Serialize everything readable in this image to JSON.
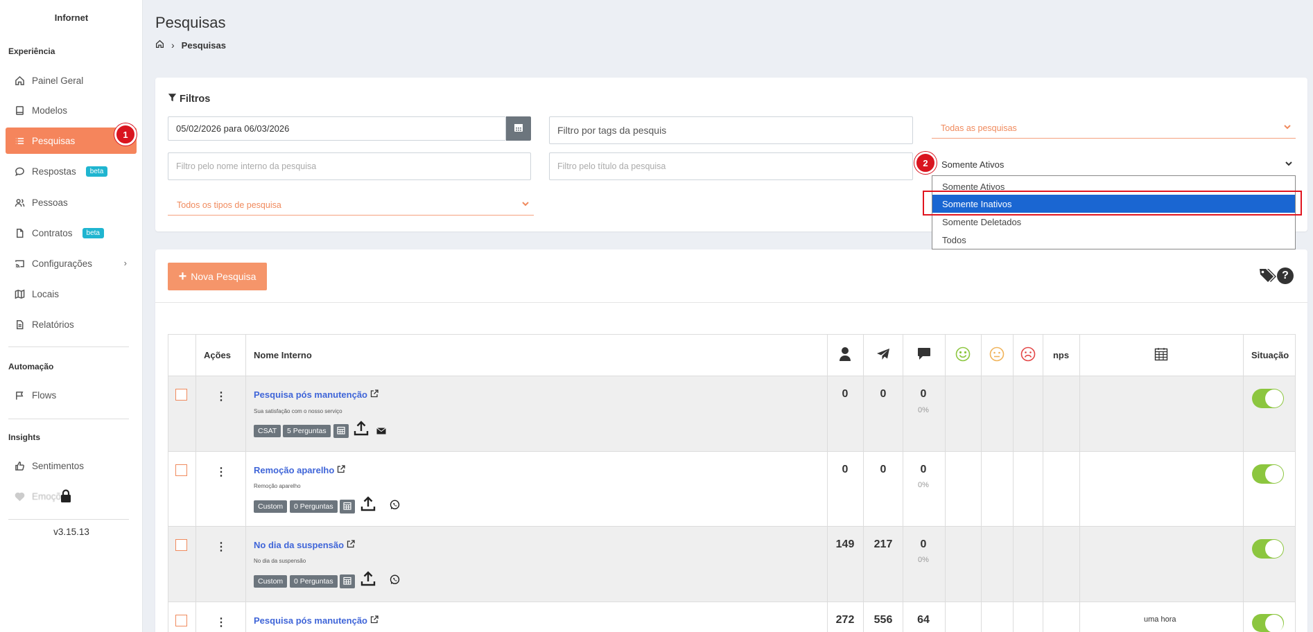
{
  "sidebar": {
    "brand": "Infornet",
    "sections": {
      "experiencia": "Experiência",
      "automacao": "Automação",
      "insights": "Insights"
    },
    "items": {
      "painel": "Painel Geral",
      "modelos": "Modelos",
      "pesquisas": "Pesquisas",
      "respostas": "Respostas",
      "pessoas": "Pessoas",
      "contratos": "Contratos",
      "configuracoes": "Configurações",
      "locais": "Locais",
      "relatorios": "Relatórios",
      "flows": "Flows",
      "sentimentos": "Sentimentos",
      "emocoes": "Emoções"
    },
    "beta_label": "beta",
    "version": "v3.15.13"
  },
  "annotations": {
    "badge1": "1",
    "badge2": "2"
  },
  "header": {
    "title": "Pesquisas",
    "breadcrumb_current": "Pesquisas"
  },
  "filters": {
    "title": "Filtros",
    "date_range": "05/02/2026 para 06/03/2026",
    "tags_placeholder": "Filtro por tags da pesquis",
    "internal_name_placeholder": "Filtro pelo nome interno da pesquisa",
    "title_placeholder": "Filtro pelo título da pesquisa",
    "all_surveys": "Todas as pesquisas",
    "all_types": "Todos os tipos de pesquisa",
    "status_selected": "Somente Ativos",
    "status_options": [
      "Somente Ativos",
      "Somente Inativos",
      "Somente Deletados",
      "Todos"
    ]
  },
  "toolbar": {
    "new_button": "Nova Pesquisa"
  },
  "table": {
    "headers": {
      "acoes": "Ações",
      "nome": "Nome Interno",
      "nps": "nps",
      "situacao": "Situação"
    },
    "rows": [
      {
        "title": "Pesquisa pós manutenção",
        "subtitle": "Sua satisfação com o nosso serviço",
        "type": "CSAT",
        "questions": "5 Perguntas",
        "channel": "email",
        "c1": "0",
        "c2": "0",
        "c3": "0",
        "pct": "0%",
        "date": ""
      },
      {
        "title": "Remoção aparelho",
        "subtitle": "Remoção aparelho",
        "type": "Custom",
        "questions": "0 Perguntas",
        "channel": "whatsapp",
        "c1": "0",
        "c2": "0",
        "c3": "0",
        "pct": "0%",
        "date": ""
      },
      {
        "title": "No dia da suspensão",
        "subtitle": "No dia da suspensão",
        "type": "Custom",
        "questions": "0 Perguntas",
        "channel": "whatsapp",
        "c1": "149",
        "c2": "217",
        "c3": "0",
        "pct": "0%",
        "date": ""
      },
      {
        "title": "Pesquisa pós manutenção",
        "subtitle": "",
        "type": "",
        "questions": "",
        "channel": "",
        "c1": "272",
        "c2": "556",
        "c3": "64",
        "pct": "",
        "date": "uma hora"
      }
    ]
  },
  "colors": {
    "accent": "#f5855c",
    "link": "#3f65d8",
    "toggle_on": "#8cc63f",
    "dropdown_selected": "#1a66d2",
    "annotation_red": "#d9141f"
  }
}
